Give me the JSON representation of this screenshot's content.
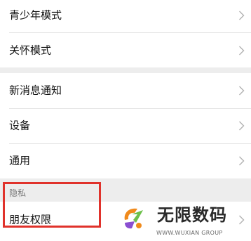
{
  "settings": {
    "group1": [
      {
        "label": "青少年模式"
      },
      {
        "label": "关怀模式"
      }
    ],
    "group2": [
      {
        "label": "新消息通知"
      },
      {
        "label": "设备"
      },
      {
        "label": "通用"
      }
    ],
    "privacy_section": {
      "header": "隐私",
      "items": [
        {
          "label": "朋友权限"
        }
      ]
    }
  },
  "watermark": {
    "title": "无限数码",
    "url": "WWW.WUXIAN GROUP",
    "colors": {
      "orange": "#f08a1c",
      "green": "#6cc04a",
      "purple": "#8a4fd1"
    }
  },
  "colors": {
    "highlight": "#e0322b",
    "chevron": "#b2b2b2",
    "page_bg": "#ededed"
  }
}
